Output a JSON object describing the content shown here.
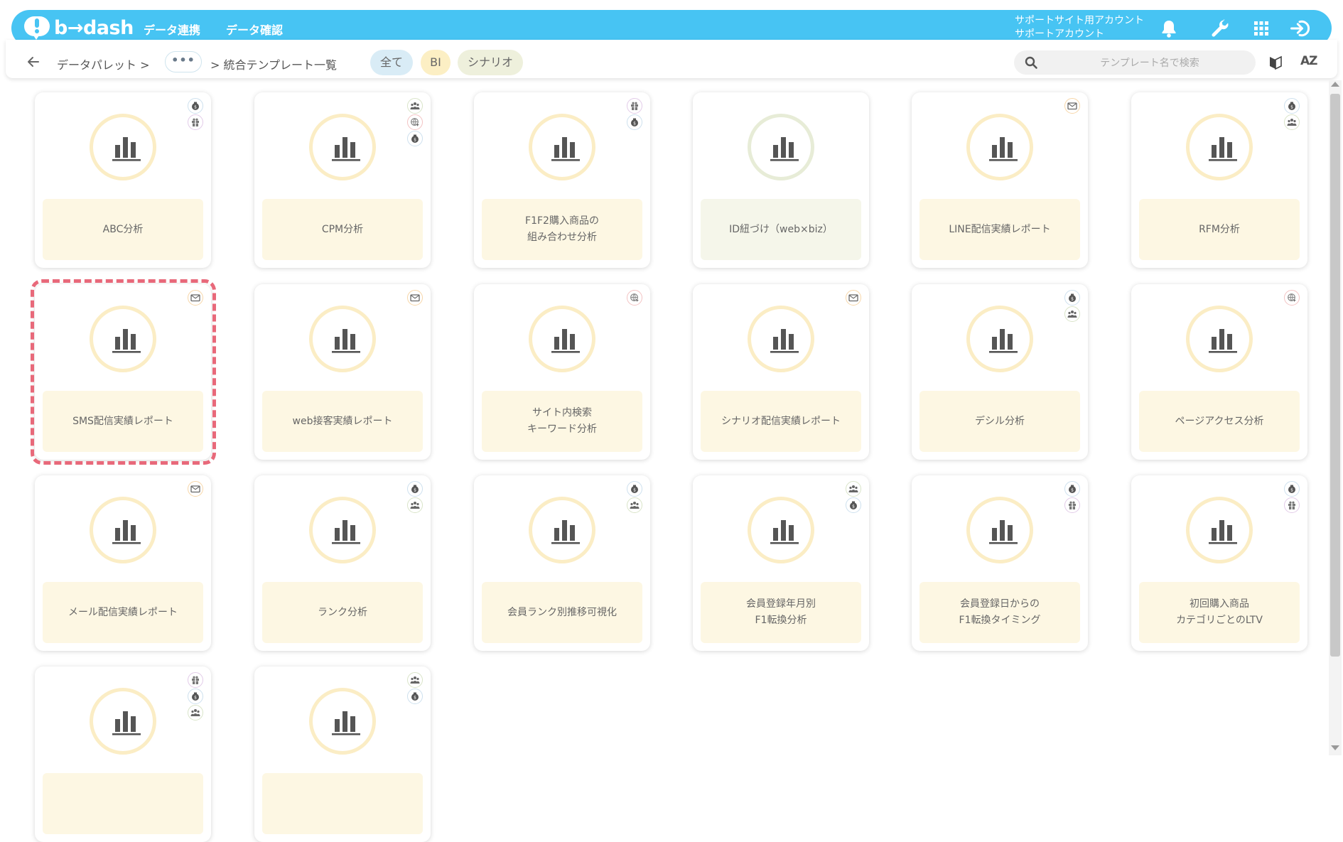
{
  "header": {
    "logo_text": "b→dash",
    "nav": [
      "データ連携",
      "データ確認"
    ],
    "account_line1": "サポートサイト用アカウント",
    "account_line2": "サポートアカウント",
    "icons": [
      "bell-icon",
      "wrench-icon",
      "grid-icon",
      "logout-icon"
    ],
    "bar_color": "#47c4f3"
  },
  "toolbar": {
    "breadcrumb_root": "データパレット >",
    "breadcrumb_ellipsis": "•••",
    "breadcrumb_current": "> 統合テンプレート一覧",
    "filters": [
      {
        "label": "全て",
        "active": true,
        "color": "#d9ecf6"
      },
      {
        "label": "BI",
        "active": false,
        "color": "#fcefc4"
      },
      {
        "label": "シナリオ",
        "active": false,
        "color": "#eef0dc"
      }
    ],
    "search_placeholder": "テンプレート名で検索",
    "sort_label": "AZ"
  },
  "cards": [
    {
      "title": "ABC分析",
      "badges": [
        "money",
        "gift"
      ],
      "style": "bi"
    },
    {
      "title": "CPM分析",
      "badges": [
        "people",
        "web",
        "money"
      ],
      "style": "bi"
    },
    {
      "title": "F1F2購入商品の\n組み合わせ分析",
      "badges": [
        "gift",
        "money"
      ],
      "style": "bi"
    },
    {
      "title": "ID紐づけ（web×biz）",
      "badges": [],
      "style": "scenario"
    },
    {
      "title": "LINE配信実績レポート",
      "badges": [
        "mail"
      ],
      "style": "bi"
    },
    {
      "title": "RFM分析",
      "badges": [
        "money",
        "people"
      ],
      "style": "bi"
    },
    {
      "title": "SMS配信実績レポート",
      "badges": [
        "mail"
      ],
      "style": "bi",
      "highlighted": true
    },
    {
      "title": "web接客実績レポート",
      "badges": [
        "mail"
      ],
      "style": "bi"
    },
    {
      "title": "サイト内検索\nキーワード分析",
      "badges": [
        "web"
      ],
      "style": "bi"
    },
    {
      "title": "シナリオ配信実績レポート",
      "badges": [
        "mail"
      ],
      "style": "bi"
    },
    {
      "title": "デシル分析",
      "badges": [
        "money",
        "people"
      ],
      "style": "bi"
    },
    {
      "title": "ページアクセス分析",
      "badges": [
        "web"
      ],
      "style": "bi"
    },
    {
      "title": "メール配信実績レポート",
      "badges": [
        "mail"
      ],
      "style": "bi"
    },
    {
      "title": "ランク分析",
      "badges": [
        "money",
        "people"
      ],
      "style": "bi"
    },
    {
      "title": "会員ランク別推移可視化",
      "badges": [
        "money",
        "people"
      ],
      "style": "bi"
    },
    {
      "title": "会員登録年月別\nF1転換分析",
      "badges": [
        "people",
        "money"
      ],
      "style": "bi"
    },
    {
      "title": "会員登録日からの\nF1転換タイミング",
      "badges": [
        "money",
        "gift"
      ],
      "style": "bi"
    },
    {
      "title": "初回購入商品\nカテゴリごとのLTV",
      "badges": [
        "money",
        "gift"
      ],
      "style": "bi"
    },
    {
      "title": "",
      "badges": [
        "gift",
        "money",
        "people"
      ],
      "style": "bi"
    },
    {
      "title": "",
      "badges": [
        "people",
        "money"
      ],
      "style": "bi"
    }
  ]
}
